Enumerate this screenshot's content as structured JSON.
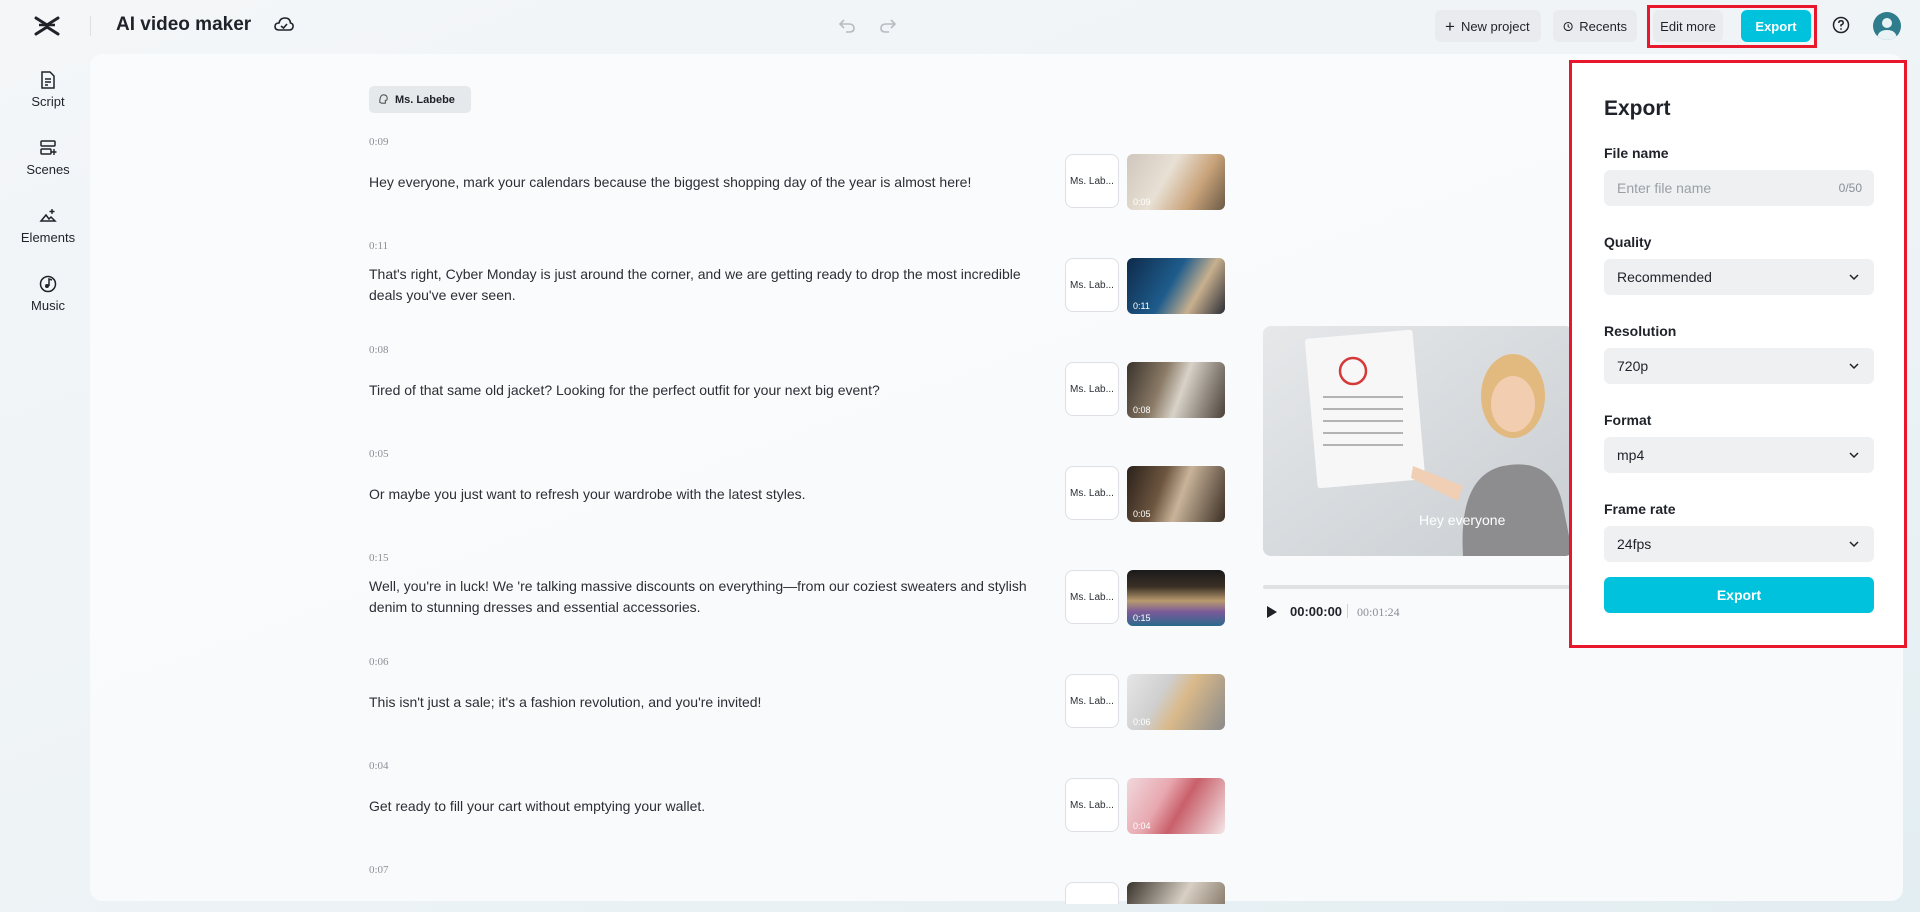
{
  "app": {
    "title": "AI video maker"
  },
  "toolbar": {
    "new_project": "New project",
    "recents": "Recents",
    "edit_more": "Edit more",
    "export": "Export"
  },
  "sidebar": {
    "items": [
      {
        "label": "Script",
        "icon": "script-icon"
      },
      {
        "label": "Scenes",
        "icon": "scenes-icon"
      },
      {
        "label": "Elements",
        "icon": "elements-icon"
      },
      {
        "label": "Music",
        "icon": "music-icon"
      }
    ]
  },
  "speaker": {
    "name": "Ms. Labebe"
  },
  "scenes": [
    {
      "time": "0:09",
      "text": "Hey everyone, mark your calendars because the biggest shopping day of the year is almost here!",
      "voice": "Ms. Lab...",
      "duration": "0:09"
    },
    {
      "time": "0:11",
      "text": "That's right, Cyber Monday is just around the corner, and we are getting ready to drop the most incredible deals you've ever seen.",
      "voice": "Ms. Lab...",
      "duration": "0:11"
    },
    {
      "time": "0:08",
      "text": "Tired of that same old jacket? Looking for the perfect outfit for your next big event?",
      "voice": "Ms. Lab...",
      "duration": "0:08"
    },
    {
      "time": "0:05",
      "text": "Or maybe you just want to refresh your wardrobe with the latest styles.",
      "voice": "Ms. Lab...",
      "duration": "0:05"
    },
    {
      "time": "0:15",
      "text": "Well, you're in luck! We 're talking massive discounts on everything—from our coziest sweaters and stylish denim to stunning dresses and essential accessories.",
      "voice": "Ms. Lab...",
      "duration": "0:15"
    },
    {
      "time": "0:06",
      "text": "This isn't just a sale; it's a fashion revolution, and you're invited!",
      "voice": "Ms. Lab...",
      "duration": "0:06"
    },
    {
      "time": "0:04",
      "text": "Get ready to fill your cart without emptying your wallet.",
      "voice": "Ms. Lab...",
      "duration": "0:04"
    },
    {
      "time": "0:07",
      "text": "",
      "voice": "",
      "duration": ""
    }
  ],
  "preview": {
    "caption": "Hey everyone",
    "current_time": "00:00:00",
    "total_time": "00:01:24",
    "progress": 0
  },
  "export_panel": {
    "title": "Export",
    "file_name_label": "File name",
    "file_name_placeholder": "Enter file name",
    "file_name_value": "",
    "file_name_count": "0/50",
    "quality_label": "Quality",
    "quality_value": "Recommended",
    "resolution_label": "Resolution",
    "resolution_value": "720p",
    "format_label": "Format",
    "format_value": "mp4",
    "frame_rate_label": "Frame rate",
    "frame_rate_value": "24fps",
    "export_button": "Export"
  },
  "colors": {
    "accent": "#00c2dd",
    "highlight": "#e8172c"
  }
}
